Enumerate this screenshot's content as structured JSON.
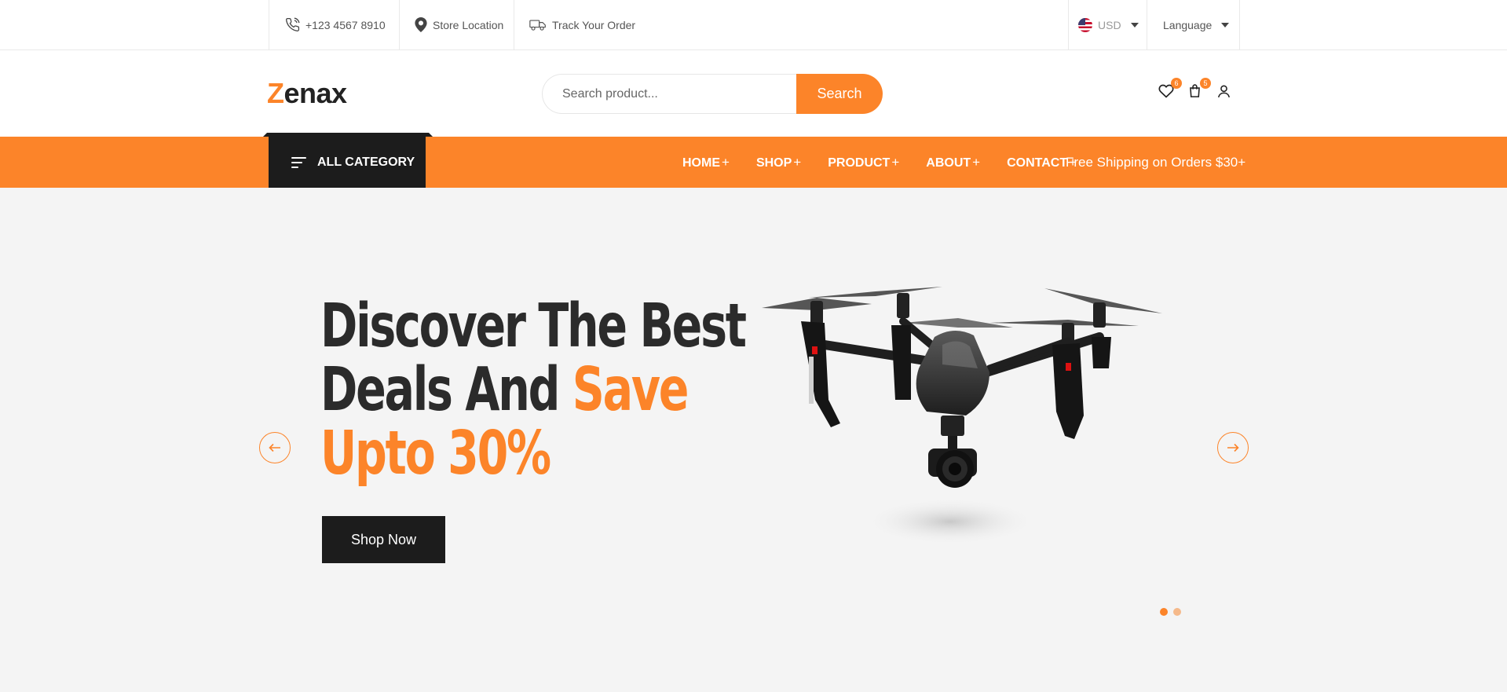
{
  "topbar": {
    "phone": "+123 4567 8910",
    "store": "Store Location",
    "track": "Track Your Order",
    "currency": "USD",
    "language": "Language"
  },
  "header": {
    "logo_initial": "Z",
    "logo_rest": "enax",
    "search_placeholder": "Search product...",
    "search_button": "Search",
    "wishlist_count": "6",
    "cart_count": "5"
  },
  "nav": {
    "all_category": "ALL CATEGORY",
    "items": [
      {
        "label": "HOME"
      },
      {
        "label": "SHOP"
      },
      {
        "label": "PRODUCT"
      },
      {
        "label": "ABOUT"
      },
      {
        "label": "CONTACT"
      }
    ],
    "plus": "+",
    "free_shipping": "Free Shipping on Orders $30+"
  },
  "hero": {
    "line1": "Discover The Best",
    "line2_dark": "Deals And ",
    "line2_accent": "Save",
    "line3": "Upto 30%",
    "cta": "Shop Now"
  },
  "slider": {
    "active_index": 0,
    "count": 2
  },
  "colors": {
    "accent": "#fc8429",
    "dark": "#1c1c1c",
    "hero_bg": "#f4f4f4",
    "dot_inactive": "#f5b98a"
  },
  "icons": {
    "phone": "phone-icon",
    "store": "map-pin-icon",
    "track": "truck-icon",
    "wishlist": "heart-icon",
    "cart": "shopping-bag-icon",
    "account": "user-icon",
    "category": "menu-lines-icon",
    "prev": "arrow-left-icon",
    "next": "arrow-right-icon"
  }
}
